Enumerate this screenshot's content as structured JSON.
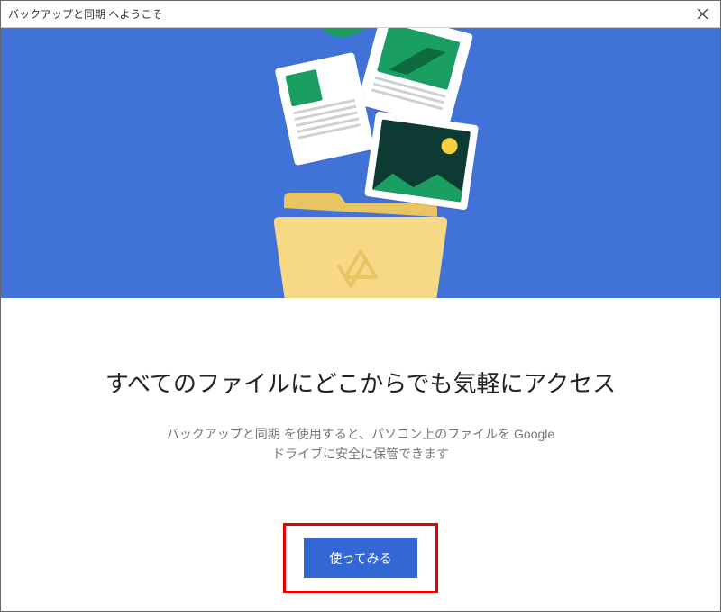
{
  "window": {
    "title": "バックアップと同期 へようこそ"
  },
  "content": {
    "headline": "すべてのファイルにどこからでも気軽にアクセス",
    "subtext_line1": "バックアップと同期 を使用すると、パソコン上のファイルを Google",
    "subtext_line2": "ドライブに安全に保管できます"
  },
  "actions": {
    "get_started": "使ってみる"
  }
}
